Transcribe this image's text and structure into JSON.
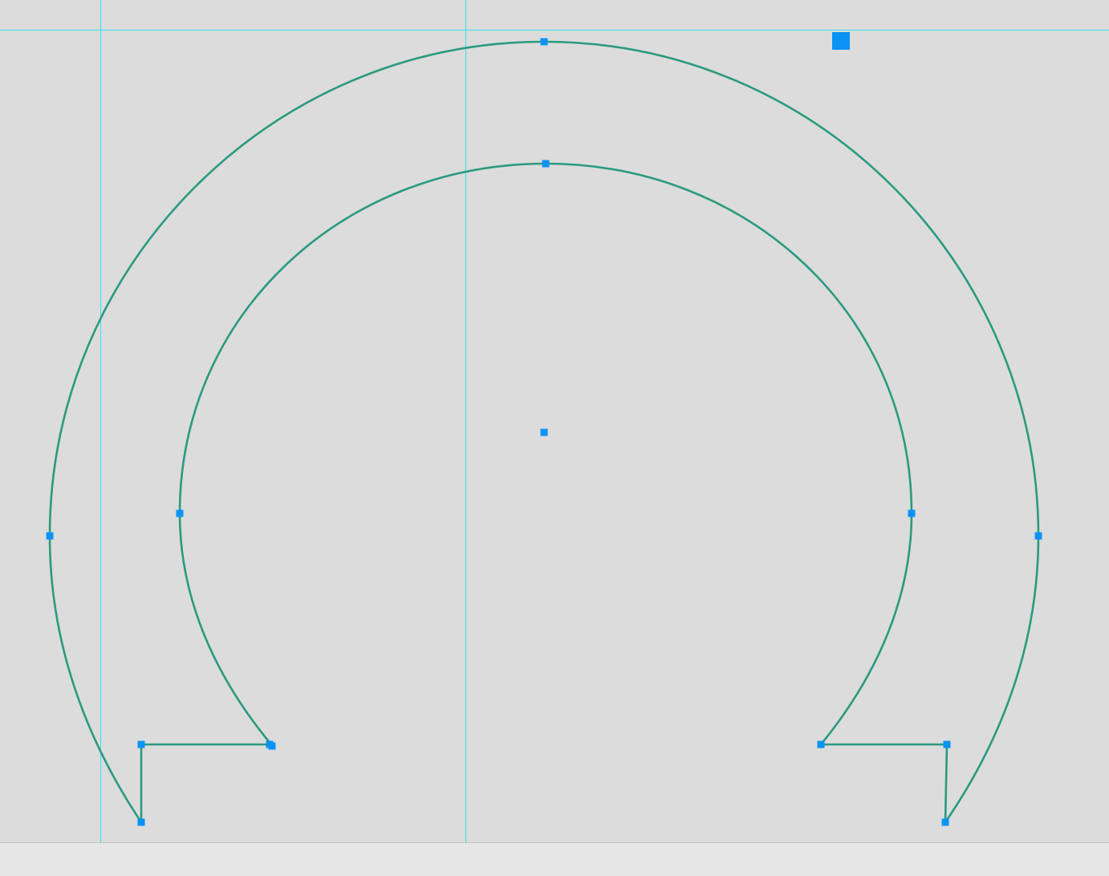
{
  "canvas": {
    "background_color": "#dcdcdc",
    "path_stroke_color": "#2a9a80",
    "anchor_color": "#0a93f5",
    "guide_color": "#2ee6ec",
    "path_closed": true
  },
  "status_bar": {
    "background_color": "#e6e6e6"
  }
}
